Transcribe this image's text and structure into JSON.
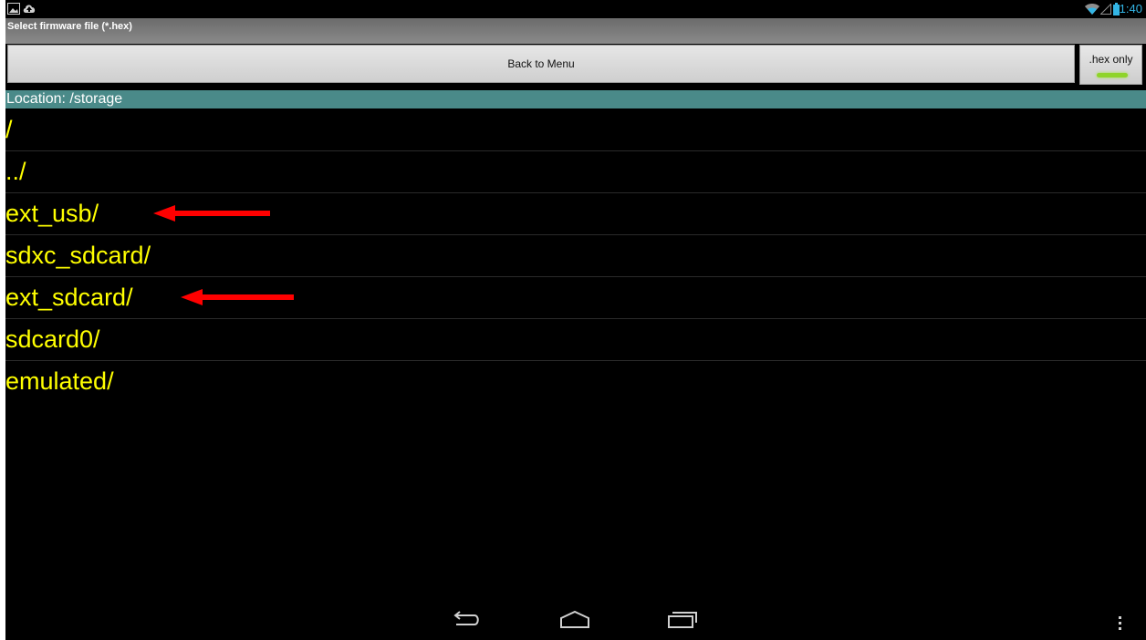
{
  "status_bar": {
    "time": "11:40",
    "left_icons": [
      "gallery-icon",
      "cloud-upload-icon"
    ],
    "right_icons": [
      "wifi-icon",
      "signal-icon",
      "battery-icon"
    ],
    "accent_color": "#33b5e5"
  },
  "title_bar": {
    "title": "Select firmware file (*.hex)"
  },
  "toolbar": {
    "back_label": "Back to Menu",
    "hex_toggle_label": ".hex only",
    "hex_toggle_on": true,
    "hex_indicator_color": "#8fd42a"
  },
  "location": {
    "label": "Location: /storage",
    "bar_color": "#4a8a89"
  },
  "files": [
    {
      "label": "/"
    },
    {
      "label": "../"
    },
    {
      "label": "ext_usb/",
      "annotated": true
    },
    {
      "label": "sdxc_sdcard/"
    },
    {
      "label": "ext_sdcard/",
      "annotated": true
    },
    {
      "label": "sdcard0/"
    },
    {
      "label": "emulated/"
    }
  ],
  "file_text_color": "#ffff00",
  "annotation_color": "#ff0000",
  "nav_bar": {
    "icons": [
      "back-icon",
      "home-icon",
      "recents-icon",
      "overflow-menu-icon"
    ]
  }
}
